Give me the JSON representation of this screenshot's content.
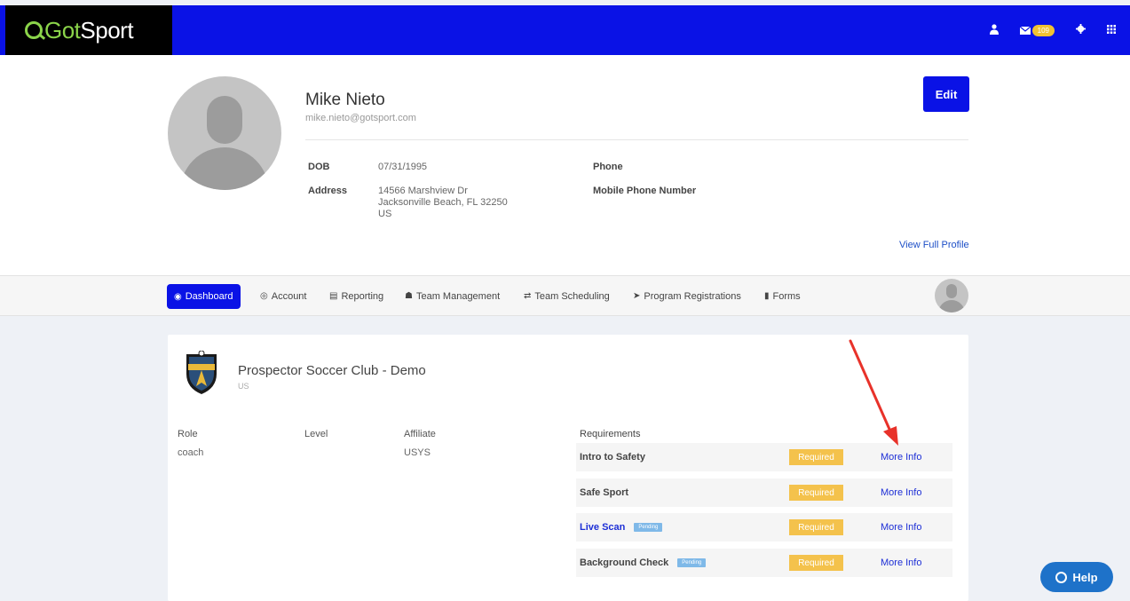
{
  "header": {
    "logo_prefix": "Got",
    "logo_suffix": "Sport",
    "mail_badge": "109"
  },
  "profile": {
    "name": "Mike Nieto",
    "email": "mike.nieto@gotsport.com",
    "dob_label": "DOB",
    "dob_value": "07/31/1995",
    "address_label": "Address",
    "address_line1": "14566 Marshview Dr",
    "address_line2": "Jacksonville Beach, FL 32250",
    "address_line3": "US",
    "phone_label": "Phone",
    "mobile_label": "Mobile Phone Number",
    "edit_label": "Edit",
    "view_full_label": "View Full Profile"
  },
  "nav": {
    "items": [
      {
        "label": "Dashboard",
        "icon": "dashboard-icon"
      },
      {
        "label": "Account",
        "icon": "user-circle-icon"
      },
      {
        "label": "Reporting",
        "icon": "document-icon"
      },
      {
        "label": "Team Management",
        "icon": "users-icon"
      },
      {
        "label": "Team Scheduling",
        "icon": "exchange-icon"
      },
      {
        "label": "Program Registrations",
        "icon": "send-icon"
      },
      {
        "label": "Forms",
        "icon": "file-icon"
      }
    ]
  },
  "club": {
    "name": "Prospector Soccer Club - Demo",
    "country": "US",
    "columns": {
      "role": "Role",
      "level": "Level",
      "affiliate": "Affiliate"
    },
    "row": {
      "role": "coach",
      "level": "",
      "affiliate": "USYS"
    }
  },
  "requirements": {
    "header": "Requirements",
    "required_label": "Required",
    "more_info_label": "More Info",
    "pending_label": "Pending",
    "items": [
      {
        "name": "Intro to Safety",
        "pending": false
      },
      {
        "name": "Safe Sport",
        "pending": false
      },
      {
        "name": "Live Scan",
        "pending": true
      },
      {
        "name": "Background Check",
        "pending": true
      }
    ]
  },
  "help_label": "Help",
  "colors": {
    "brand_blue": "#0a12e6",
    "brand_green": "#8bd44a",
    "required_yellow": "#f4c24c",
    "pending_blue": "#7fb9e8",
    "help_blue": "#1e72c9",
    "arrow_red": "#e8322a"
  }
}
